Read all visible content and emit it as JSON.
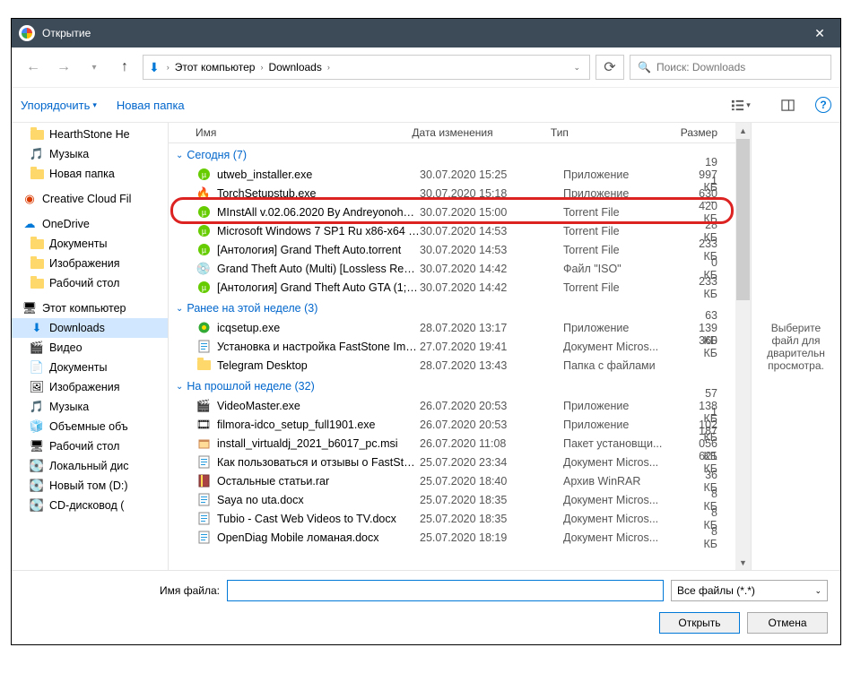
{
  "window": {
    "title": "Открытие"
  },
  "nav": {
    "path_root": "Этот компьютер",
    "path_folder": "Downloads",
    "search_placeholder": "Поиск: Downloads"
  },
  "toolbar": {
    "organize": "Упорядочить",
    "new_folder": "Новая папка"
  },
  "sidebar": [
    {
      "label": "HearthStone  He",
      "icon": "folder"
    },
    {
      "label": "Музыка",
      "icon": "music"
    },
    {
      "label": "Новая папка",
      "icon": "folder"
    },
    {
      "label": "Creative Cloud Fil",
      "icon": "cc",
      "root": true
    },
    {
      "label": "OneDrive",
      "icon": "onedrive",
      "root": true
    },
    {
      "label": "Документы",
      "icon": "folder"
    },
    {
      "label": "Изображения",
      "icon": "folder"
    },
    {
      "label": "Рабочий стол",
      "icon": "folder"
    },
    {
      "label": "Этот компьютер",
      "icon": "pc",
      "root": true
    },
    {
      "label": "Downloads",
      "icon": "download",
      "sel": true
    },
    {
      "label": "Видео",
      "icon": "video"
    },
    {
      "label": "Документы",
      "icon": "docs"
    },
    {
      "label": "Изображения",
      "icon": "images"
    },
    {
      "label": "Музыка",
      "icon": "music2"
    },
    {
      "label": "Объемные объ",
      "icon": "3d"
    },
    {
      "label": "Рабочий стол",
      "icon": "desktop"
    },
    {
      "label": "Локальный дис",
      "icon": "disk"
    },
    {
      "label": "Новый том (D:)",
      "icon": "disk"
    },
    {
      "label": "CD-дисковод (",
      "icon": "cd"
    }
  ],
  "columns": {
    "name": "Имя",
    "date": "Дата изменения",
    "type": "Тип",
    "size": "Размер"
  },
  "groups": [
    {
      "title": "Сегодня (7)",
      "files": [
        {
          "icon": "ut",
          "name": "utweb_installer.exe",
          "date": "30.07.2020 15:25",
          "type": "Приложение",
          "size": "19 997 КБ"
        },
        {
          "icon": "torch",
          "name": "TorchSetupstub.exe",
          "date": "30.07.2020 15:18",
          "type": "Приложение",
          "size": "1 630 КБ"
        },
        {
          "icon": "torrent",
          "name": "MInstAll v.02.06.2020 By Andreyonohov ...",
          "date": "30.07.2020 15:00",
          "type": "Torrent File",
          "size": "420 КБ",
          "hl": true
        },
        {
          "icon": "torrent",
          "name": "Microsoft Windows 7 SP1 Ru x86-x64 Ori...",
          "date": "30.07.2020 14:53",
          "type": "Torrent File",
          "size": "28 КБ"
        },
        {
          "icon": "torrent",
          "name": "[Антология] Grand Theft Auto.torrent",
          "date": "30.07.2020 14:53",
          "type": "Torrent File",
          "size": "233 КБ"
        },
        {
          "icon": "iso",
          "name": "Grand Theft Auto (Multi) [Lossless RePac...",
          "date": "30.07.2020 14:42",
          "type": "Файл \"ISO\"",
          "size": "0 КБ"
        },
        {
          "icon": "torrent",
          "name": "[Антология] Grand Theft Auto GTA (1; Lo...",
          "date": "30.07.2020 14:42",
          "type": "Torrent File",
          "size": "233 КБ"
        }
      ]
    },
    {
      "title": "Ранее на этой неделе (3)",
      "files": [
        {
          "icon": "icq",
          "name": "icqsetup.exe",
          "date": "28.07.2020 13:17",
          "type": "Приложение",
          "size": "63 139 КБ"
        },
        {
          "icon": "doc",
          "name": "Установка и настройка FastStone Image...",
          "date": "27.07.2020 19:41",
          "type": "Документ Micros...",
          "size": "360 КБ"
        },
        {
          "icon": "folder",
          "name": "Telegram Desktop",
          "date": "28.07.2020 13:43",
          "type": "Папка с файлами",
          "size": ""
        }
      ]
    },
    {
      "title": "На прошлой неделе (32)",
      "files": [
        {
          "icon": "vm",
          "name": "VideoMaster.exe",
          "date": "26.07.2020 20:53",
          "type": "Приложение",
          "size": "57 138 КБ"
        },
        {
          "icon": "film",
          "name": "filmora-idco_setup_full1901.exe",
          "date": "26.07.2020 20:53",
          "type": "Приложение",
          "size": "1 102 КБ"
        },
        {
          "icon": "msi",
          "name": "install_virtualdj_2021_b6017_pc.msi",
          "date": "26.07.2020 11:08",
          "type": "Пакет установщи...",
          "size": "187 056 КБ"
        },
        {
          "icon": "doc",
          "name": "Как пользоваться и отзывы о FastStone ...",
          "date": "25.07.2020 23:34",
          "type": "Документ Micros...",
          "size": "621 КБ"
        },
        {
          "icon": "rar",
          "name": "Остальные статьи.rar",
          "date": "25.07.2020 18:40",
          "type": "Архив WinRAR",
          "size": "36 КБ"
        },
        {
          "icon": "doc",
          "name": "Saya no uta.docx",
          "date": "25.07.2020 18:35",
          "type": "Документ Micros...",
          "size": "8 КБ"
        },
        {
          "icon": "doc",
          "name": "Tubio - Cast Web Videos to TV.docx",
          "date": "25.07.2020 18:35",
          "type": "Документ Micros...",
          "size": "8 КБ"
        },
        {
          "icon": "doc",
          "name": "OpenDiag Mobile ломаная.docx",
          "date": "25.07.2020 18:19",
          "type": "Документ Micros...",
          "size": "8 КБ"
        }
      ]
    }
  ],
  "preview": {
    "text": "Выберите\nфайл для\nдварительн\nпросмотра."
  },
  "footer": {
    "filename_label": "Имя файла:",
    "filter": "Все файлы (*.*)",
    "open": "Открыть",
    "cancel": "Отмена"
  },
  "icons": {
    "ut": "🟢",
    "torch": "🔥",
    "torrent": "🟢",
    "iso": "💿",
    "icq": "🌼",
    "doc": "📄",
    "folder": "📁",
    "vm": "🎬",
    "film": "🎞",
    "msi": "📦",
    "rar": "📕",
    "music": "🎵",
    "cc": "🟥",
    "onedrive": "☁",
    "pc": "🖥",
    "download": "⬇",
    "video": "🎬",
    "docs": "📄",
    "images": "🖼",
    "music2": "🎵",
    "3d": "🧊",
    "desktop": "🖥",
    "disk": "💽",
    "cd": "💿"
  }
}
